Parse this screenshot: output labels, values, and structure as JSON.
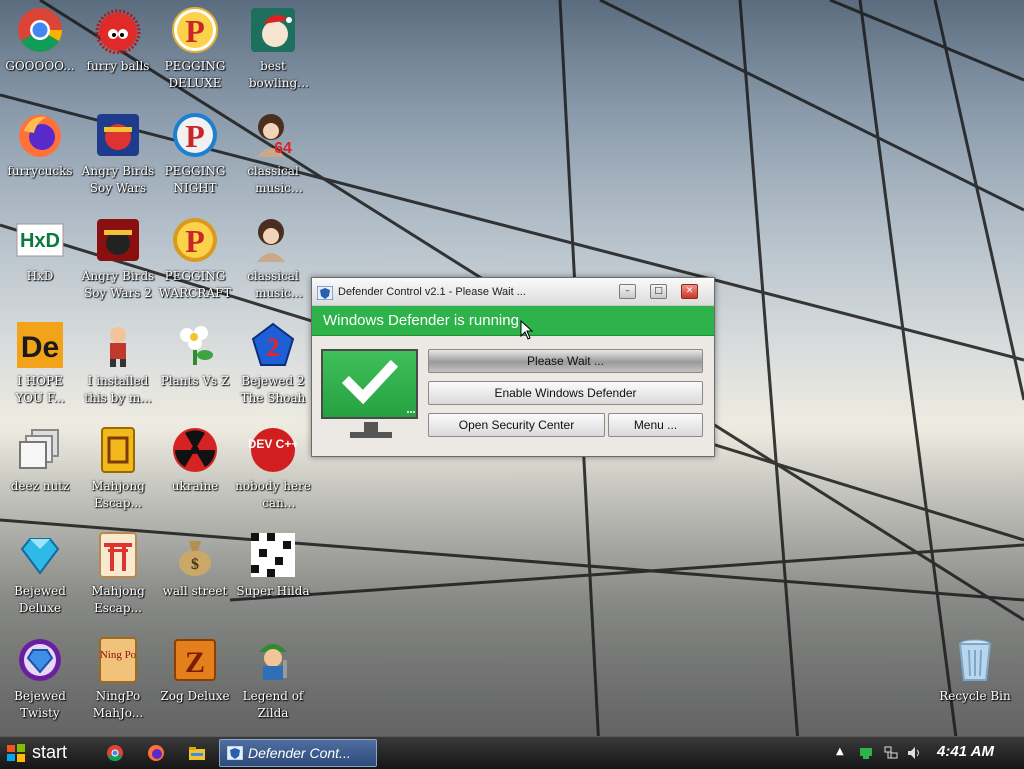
{
  "desktop": {
    "icons": [
      {
        "label": "GOOOOO..."
      },
      {
        "label": "furry balls"
      },
      {
        "label": "PEGGING DELUXE"
      },
      {
        "label": "best bowling game of al..."
      },
      {
        "label": "furrycucks"
      },
      {
        "label": "Angry Birds Soy Wars"
      },
      {
        "label": "PEGGING NIGHT"
      },
      {
        "label": "classical music stati..."
      },
      {
        "label": "HxD"
      },
      {
        "label": "Angry Birds Soy Wars 2"
      },
      {
        "label": "PEGGING WARCRAFT"
      },
      {
        "label": "classical music station"
      },
      {
        "label": "I HOPE YOU F..."
      },
      {
        "label": "I installed this by m..."
      },
      {
        "label": "Plants Vs Z"
      },
      {
        "label": "Bejewed 2 The Shoah"
      },
      {
        "label": "deez nutz"
      },
      {
        "label": "Mahjong Escap..."
      },
      {
        "label": "ukraine"
      },
      {
        "label": "nobody here can program"
      },
      {
        "label": "Bejewed Deluxe"
      },
      {
        "label": "Mahjong Escap..."
      },
      {
        "label": "wall street"
      },
      {
        "label": "Super Hilda"
      },
      {
        "label": "Bejewed Twisty"
      },
      {
        "label": "NingPo MahJo..."
      },
      {
        "label": "Zog Deluxe"
      },
      {
        "label": "Legend of Zilda"
      },
      {
        "label": "Recycle Bin"
      }
    ],
    "icon_art_text": {
      "hxd": "HxD",
      "de": "De",
      "dev": "DEV C++",
      "ningpo": "Ning Po",
      "portrait_num": "64",
      "bejeweled2": "2",
      "pegging": "P",
      "zog": "Z"
    }
  },
  "window": {
    "title": "Defender Control v2.1 - Please Wait ...",
    "status": "Windows Defender is running",
    "status_color": "#2db34a",
    "buttons": {
      "please_wait": "Please Wait ...",
      "enable": "Enable Windows Defender",
      "open_security": "Open Security Center",
      "menu": "Menu ..."
    },
    "controls": {
      "minimize": "–",
      "maximize": "□",
      "close": "✕"
    }
  },
  "taskbar": {
    "start_label": "start",
    "active_task": "Defender Cont...",
    "clock": "4:41 AM",
    "tray_up_arrow": "▲"
  }
}
